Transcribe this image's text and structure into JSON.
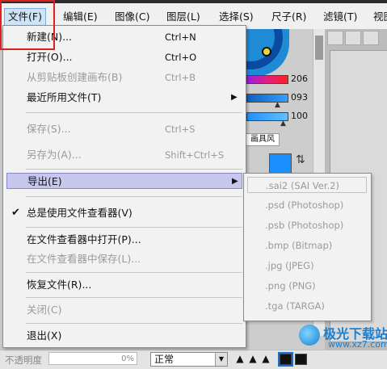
{
  "menubar": {
    "items": [
      "文件(F)",
      "编辑(E)",
      "图像(C)",
      "图层(L)",
      "选择(S)",
      "尺子(R)",
      "滤镜(T)",
      "视图"
    ]
  },
  "file_menu": {
    "items": [
      {
        "label": "新建(N)...",
        "shortcut": "Ctrl+N"
      },
      {
        "label": "打开(O)...",
        "shortcut": "Ctrl+O"
      },
      {
        "label": "从剪贴板创建画布(B)",
        "shortcut": "Ctrl+B"
      },
      {
        "label": "最近所用文件(T)",
        "shortcut": ""
      },
      {
        "label": "保存(S)...",
        "shortcut": "Ctrl+S"
      },
      {
        "label": "另存为(A)...",
        "shortcut": "Shift+Ctrl+S"
      },
      {
        "label": "导出(E)",
        "shortcut": ""
      },
      {
        "label": "总是使用文件查看器(V)",
        "shortcut": ""
      },
      {
        "label": "在文件查看器中打开(P)...",
        "shortcut": ""
      },
      {
        "label": "在文件查看器中保存(L)...",
        "shortcut": ""
      },
      {
        "label": "恢复文件(R)...",
        "shortcut": ""
      },
      {
        "label": "关闭(C)",
        "shortcut": ""
      },
      {
        "label": "退出(X)",
        "shortcut": ""
      }
    ],
    "submenu_arrow": "▶",
    "check_mark": "✔"
  },
  "export_submenu": {
    "items": [
      ".sai2 (SAI Ver.2)",
      ".psd (Photoshop)",
      ".psb (Photoshop)",
      ".bmp (Bitmap)",
      ".jpg (JPEG)",
      ".png (PNG)",
      ".tga (TARGA)"
    ]
  },
  "sliders": {
    "v1": "206",
    "v2": "093",
    "v3": "100"
  },
  "panel": {
    "tab_label": "画具风"
  },
  "bottom": {
    "opacity_label": "不透明度",
    "opacity_value": "0%",
    "blend_mode": "正常"
  },
  "watermark": {
    "title": "极光下载站",
    "url": "www.xz7.com"
  },
  "colors": {
    "highlight": "#c7c7ee",
    "accent_box": "#e02020",
    "primary": "#1a90ff"
  }
}
